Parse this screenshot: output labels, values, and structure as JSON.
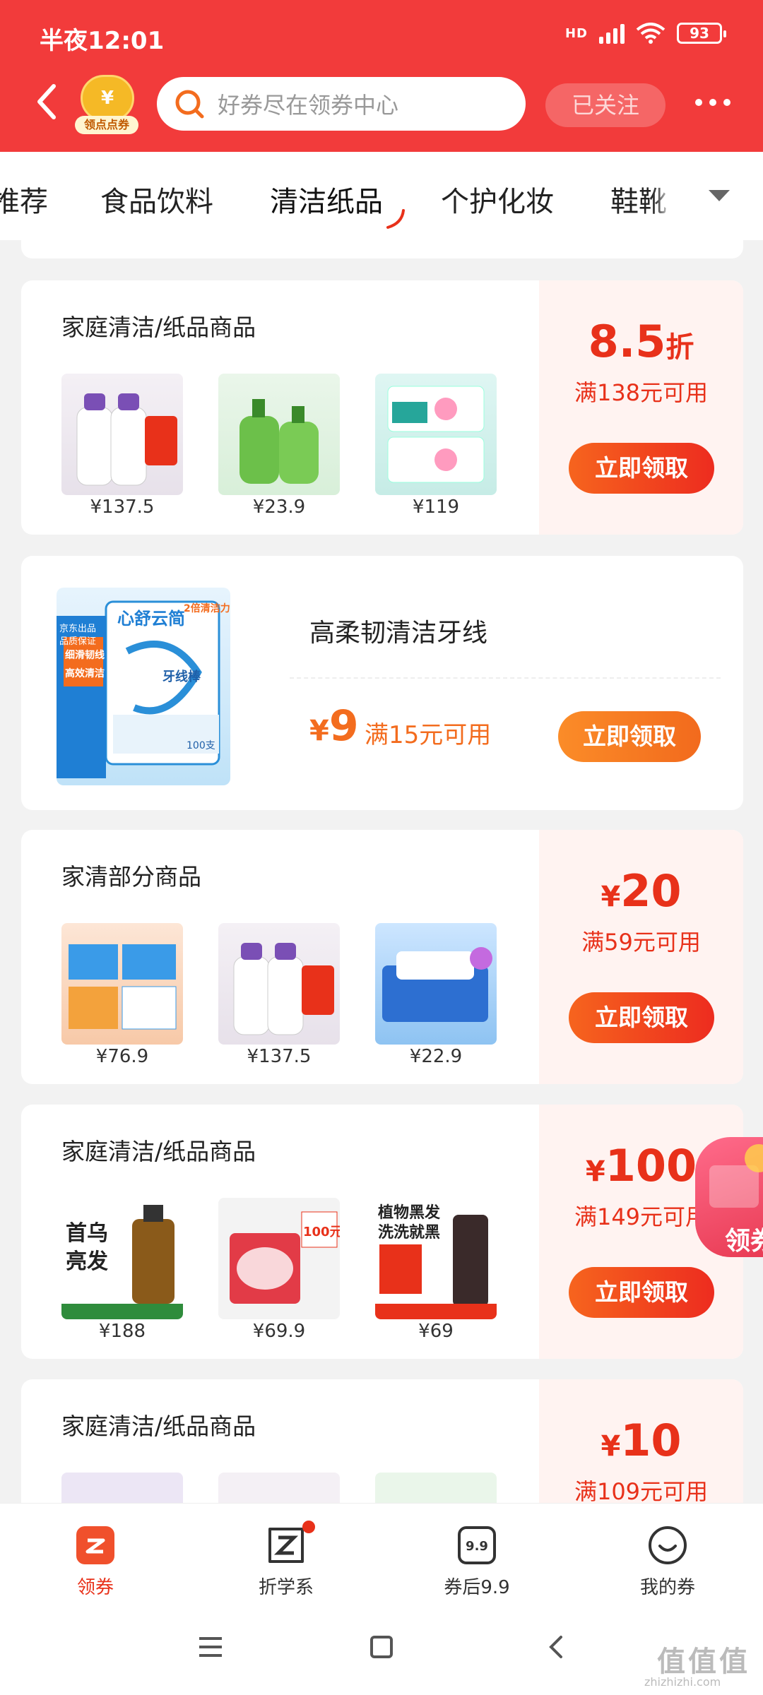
{
  "status_bar": {
    "time": "半夜12:01",
    "network": "HD",
    "battery": "93"
  },
  "header": {
    "coupon_badge_label": "领点点券",
    "coupon_badge_symbol": "¥",
    "search_placeholder": "好券尽在领券中心",
    "follow_label": "已关注"
  },
  "tabs": {
    "items": [
      "推荐",
      "食品饮料",
      "清洁纸品",
      "个护化妆",
      "鞋靴"
    ],
    "active": "清洁纸品"
  },
  "cards": [
    {
      "title": "家庭清洁/纸品商品",
      "products": [
        {
          "price": "¥137.5",
          "image": "laundry-detergent-bottles"
        },
        {
          "price": "¥23.9",
          "image": "hand-soap-bottles"
        },
        {
          "price": "¥119",
          "image": "laundry-pods-boxes"
        }
      ],
      "amount_value": "8.5",
      "amount_unit": "折",
      "condition": "满138元可用",
      "button": "立即领取"
    },
    {
      "title": "高柔韧清洁牙线",
      "image": "dental-floss-pack",
      "price_symbol": "¥",
      "price_value": "9",
      "condition": "满15元可用",
      "button": "立即领取",
      "image_text": {
        "brand": "心舒云简",
        "badge": "2倍清洁力",
        "left1": "京东出品",
        "left2": "品质保证",
        "left3": "细滑韧线",
        "left4": "高效清洁",
        "product": "牙线棒",
        "count": "100支"
      }
    },
    {
      "title": "家清部分商品",
      "products": [
        {
          "price": "¥76.9",
          "image": "tissue-boxes"
        },
        {
          "price": "¥137.5",
          "image": "laundry-detergent-bottles"
        },
        {
          "price": "¥22.9",
          "image": "tissue-packs"
        }
      ],
      "amount_symbol": "¥",
      "amount_value": "20",
      "condition": "满59元可用",
      "button": "立即领取"
    },
    {
      "title": "家庭清洁/纸品商品",
      "products": [
        {
          "price": "¥188",
          "image": "shampoo-bottle",
          "overlay": "首乌亮发"
        },
        {
          "price": "¥69.9",
          "image": "bleach-powder-tub",
          "overlay": "100元"
        },
        {
          "price": "¥69",
          "image": "hair-dye-bottle",
          "overlay": "植物黑发洗洗就黑"
        }
      ],
      "amount_symbol": "¥",
      "amount_value": "100",
      "condition": "满149元可用",
      "button": "立即领取"
    },
    {
      "title": "家庭清洁/纸品商品",
      "products": [
        {
          "price": "",
          "image": "tissue-packs"
        },
        {
          "price": "",
          "image": "laundry-detergent-bottles"
        },
        {
          "price": "",
          "image": "hand-soap-bottles"
        }
      ],
      "amount_symbol": "¥",
      "amount_value": "10",
      "condition": "满109元可用"
    }
  ],
  "floating_badge": "领券",
  "bottom_nav": [
    {
      "label": "领券",
      "icon": "coupon-icon",
      "active": true
    },
    {
      "label": "折学系",
      "icon": "z-logo-icon",
      "badge_dot": true
    },
    {
      "label": "券后9.9",
      "icon": "nine-nine-icon",
      "icon_text": "9.9"
    },
    {
      "label": "我的券",
      "icon": "smile-icon"
    }
  ],
  "watermark": {
    "text": "值值值",
    "url": "zhizhizhi.com"
  },
  "colors": {
    "header_red": "#f23b3b",
    "accent_red": "#e8311a",
    "accent_orange": "#f36c1e",
    "coupon_bg": "#fff3f1"
  }
}
